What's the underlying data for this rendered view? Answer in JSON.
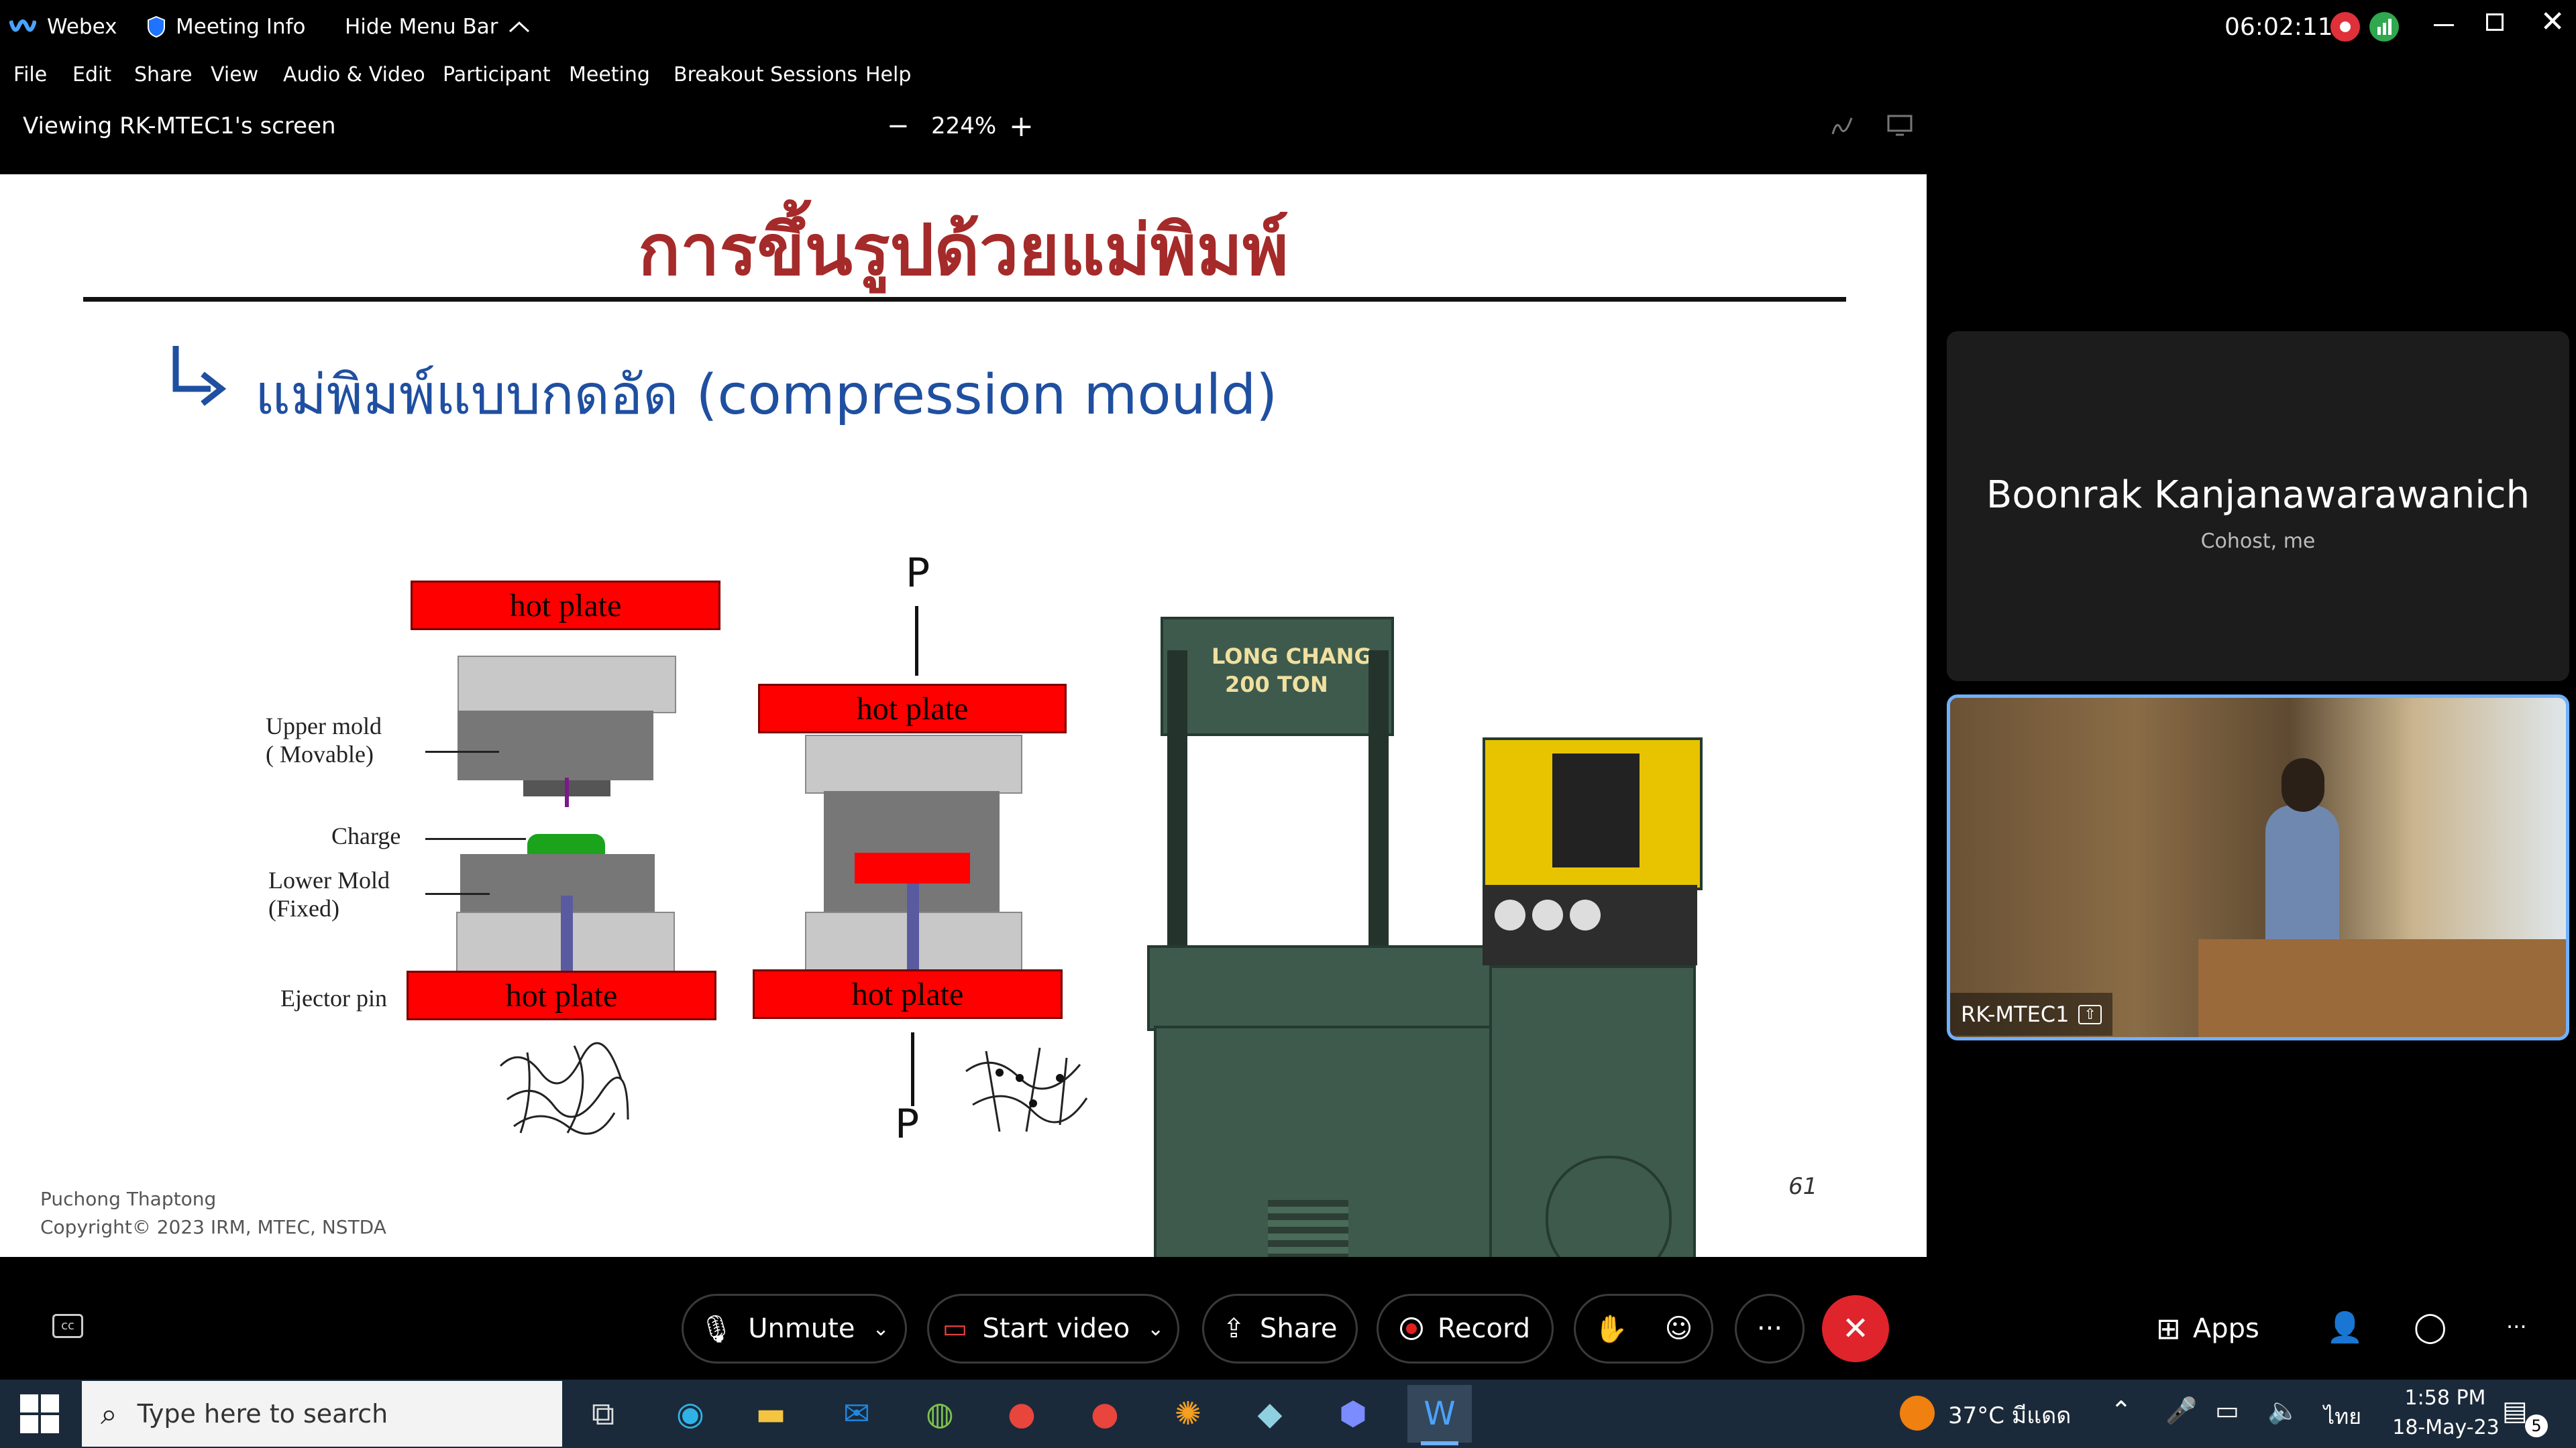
{
  "titlebar": {
    "app_name": "Webex",
    "meeting_info": "Meeting Info",
    "hide_menu": "Hide Menu Bar",
    "timer": "06:02:11"
  },
  "menu": [
    "File",
    "Edit",
    "Share",
    "View",
    "Audio & Video",
    "Participant",
    "Meeting",
    "Breakout Sessions",
    "Help"
  ],
  "viewbar": {
    "viewing": "Viewing RK-MTEC1's screen",
    "zoom": "224%",
    "zoom_out": "−",
    "zoom_in": "+"
  },
  "slide": {
    "title": "การขึ้นรูปด้วยแม่พิมพ์",
    "subtitle": "แม่พิมพ์แบบกดอัด (compression mould)",
    "hot_plate": "hot plate",
    "labels": {
      "upper_mold": "Upper mold",
      "upper_mold_2": "( Movable)",
      "charge": "Charge",
      "lower_mold": "Lower Mold",
      "lower_mold_2": "(Fixed)",
      "ejector": "Ejector pin"
    },
    "pressure": "P",
    "machine_text_1": "LONG CHANG",
    "machine_text_2": "200  TON",
    "page_number": "61",
    "author": "Puchong Thaptong",
    "copyright": "Copyright© 2023 IRM, MTEC, NSTDA"
  },
  "participants": {
    "host_name": "Boonrak Kanjanawarawanich",
    "host_role": "Cohost, me",
    "presenter_name": "RK-MTEC1"
  },
  "controls": {
    "unmute": "Unmute",
    "start_video": "Start video",
    "share": "Share",
    "record": "Record",
    "more": "···",
    "apps": "Apps",
    "overflow": "···"
  },
  "taskbar": {
    "search_placeholder": "Type here to search",
    "weather": "37°C  มีแดด",
    "language": "ไทย",
    "time": "1:58 PM",
    "date": "18-May-23",
    "notification_count": "5"
  },
  "colors": {
    "accent_blue": "#1a73e8",
    "end_red": "#e0242b",
    "hot_plate_red": "#ff0000",
    "title_red": "#a52a2a",
    "subtitle_blue": "#1f4fa0",
    "machine_green": "#3e5a4c",
    "record_red": "#e02020"
  }
}
